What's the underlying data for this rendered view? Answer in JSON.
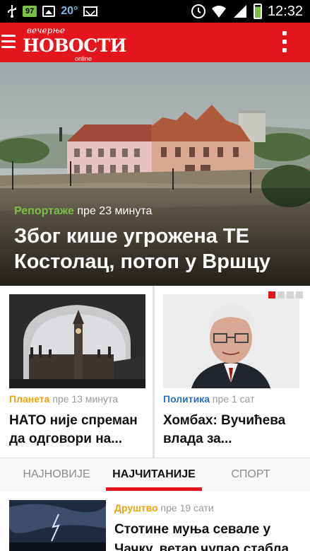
{
  "status_bar": {
    "battery_badge": "97",
    "temperature": "20°",
    "time": "12:32",
    "icons": [
      "usb-icon",
      "battery-badge",
      "picture-icon",
      "mail-icon",
      "alarm-icon",
      "wifi-icon",
      "signal-icon",
      "battery-icon"
    ]
  },
  "app_bar": {
    "logo_top": "вечерње",
    "logo_main": "НОВОСТИ",
    "logo_sub": "online",
    "brand_color": "#e3161b"
  },
  "hero": {
    "category": "Репортаже",
    "category_color": "#7ac143",
    "time": "пре 23 минута",
    "title": "Због кише угрожена ТЕ Костолац, потоп у Вршцу"
  },
  "cards": [
    {
      "category": "Планета",
      "category_color": "#f0a20a",
      "time": "пре 13 минута",
      "title": "НАТО није спреман да одговори на..."
    },
    {
      "category": "Политика",
      "category_color": "#2a6fc4",
      "time": "пре 1 сат",
      "title": "Хомбах: Вучићева влада за..."
    }
  ],
  "pager": {
    "total": 4,
    "active": 1
  },
  "tabs": [
    {
      "label": "НАЈНОВИЈЕ",
      "selected": false
    },
    {
      "label": "НАЈЧИТАНИЈЕ",
      "selected": true
    },
    {
      "label": "СПОРТ",
      "selected": false
    }
  ],
  "list": [
    {
      "category": "Друштво",
      "category_color": "#f0a20a",
      "time": "пре 19 сати",
      "title": "Стотине муња севале у Чачку, ветар чупао стабла"
    }
  ]
}
